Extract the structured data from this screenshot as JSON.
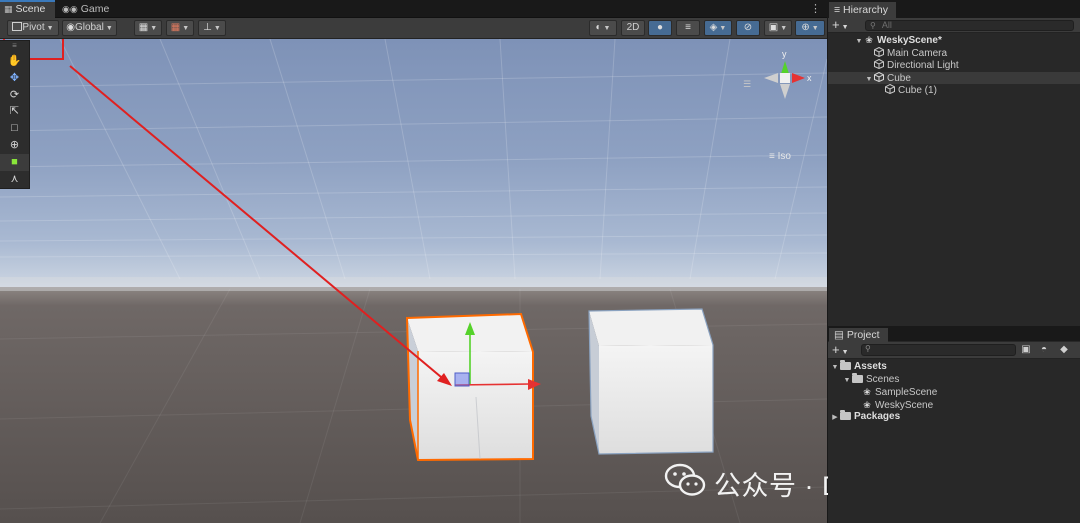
{
  "scene_tabs": [
    {
      "label": "Scene",
      "icon": "grid-icon",
      "active": true
    },
    {
      "label": "Game",
      "icon": "gamepad-icon",
      "active": false
    }
  ],
  "scene_toolbar": {
    "pivot_label": "Pivot",
    "global_label": "Global",
    "mode_2d_label": "2D"
  },
  "viewport": {
    "gizmo_labels": {
      "x": "x",
      "y": "y"
    },
    "iso_label": "Iso"
  },
  "hierarchy": {
    "tab_label": "Hierarchy",
    "search_placeholder": "All",
    "items": [
      {
        "label": "WeskyScene*",
        "type": "scene",
        "expanded": true
      },
      {
        "label": "Main Camera",
        "type": "gameobject"
      },
      {
        "label": "Directional Light",
        "type": "gameobject"
      },
      {
        "label": "Cube",
        "type": "gameobject",
        "expanded": true,
        "selected": true
      },
      {
        "label": "Cube (1)",
        "type": "gameobject"
      }
    ]
  },
  "project": {
    "tab_label": "Project",
    "items": [
      {
        "label": "Assets",
        "type": "folder",
        "expanded": true
      },
      {
        "label": "Scenes",
        "type": "folder",
        "expanded": true
      },
      {
        "label": "SampleScene",
        "type": "scene"
      },
      {
        "label": "WeskyScene",
        "type": "scene"
      },
      {
        "label": "Packages",
        "type": "folder",
        "expanded": false
      }
    ]
  },
  "watermark": {
    "text": "公众号 · Dotnet Dancer"
  },
  "colors": {
    "accent": "#3a79bb",
    "selection_outline": "#ff6a00",
    "annotation_red": "#e02020",
    "axis_x": "#e63232",
    "axis_y": "#55d22a",
    "axis_z": "#4f7cf0"
  }
}
